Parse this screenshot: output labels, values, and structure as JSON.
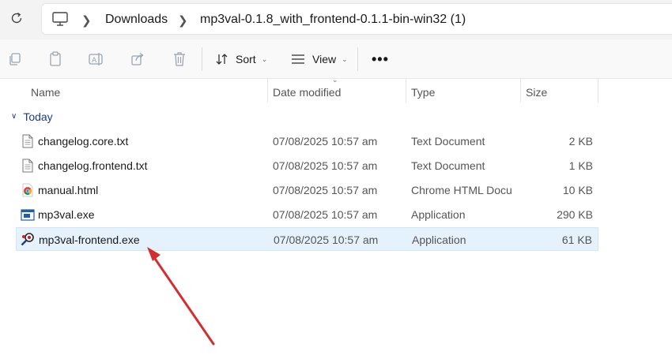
{
  "address_bar": {
    "breadcrumbs": [
      {
        "label": "Downloads"
      },
      {
        "label": "mp3val-0.1.8_with_frontend-0.1.1-bin-win32 (1)"
      }
    ]
  },
  "toolbar": {
    "sort_label": "Sort",
    "view_label": "View",
    "more_label": "•••"
  },
  "columns": {
    "name": "Name",
    "date": "Date modified",
    "type": "Type",
    "size": "Size"
  },
  "group": {
    "label": "Today"
  },
  "files": [
    {
      "name": "changelog.core.txt",
      "date": "07/08/2025 10:57 am",
      "type": "Text Document",
      "size": "2 KB",
      "icon": "text-file-icon"
    },
    {
      "name": "changelog.frontend.txt",
      "date": "07/08/2025 10:57 am",
      "type": "Text Document",
      "size": "1 KB",
      "icon": "text-file-icon"
    },
    {
      "name": "manual.html",
      "date": "07/08/2025 10:57 am",
      "type": "Chrome HTML Docu...",
      "size": "10 KB",
      "icon": "chrome-html-icon"
    },
    {
      "name": "mp3val.exe",
      "date": "07/08/2025 10:57 am",
      "type": "Application",
      "size": "290 KB",
      "icon": "console-app-icon"
    },
    {
      "name": "mp3val-frontend.exe",
      "date": "07/08/2025 10:57 am",
      "type": "Application",
      "size": "61 KB",
      "icon": "mp3val-frontend-icon",
      "selected": true
    }
  ],
  "annotation": {
    "color": "#d32f2f"
  }
}
